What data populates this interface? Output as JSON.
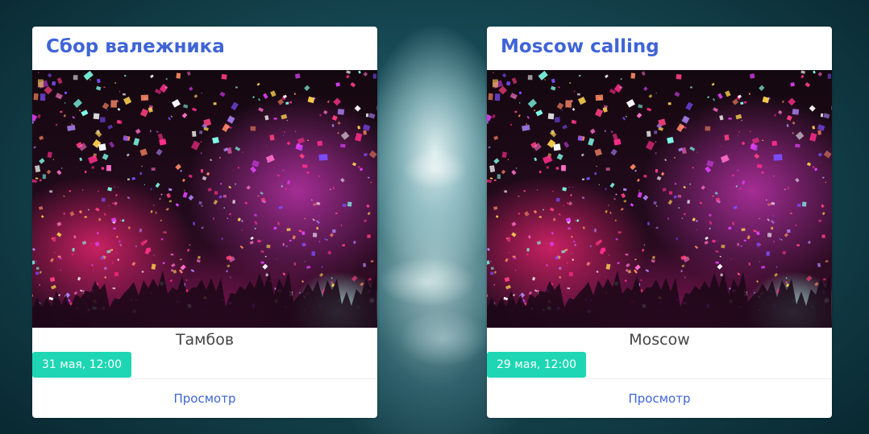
{
  "cards": [
    {
      "title": "Сбор валежника",
      "city": "Тамбов",
      "date": "31 мая, 12:00",
      "action_label": "Просмотр",
      "image": "concert-confetti-photo"
    },
    {
      "title": "Moscow calling",
      "city": "Moscow",
      "date": "29 мая, 12:00",
      "action_label": "Просмотр",
      "image": "concert-confetti-photo"
    }
  ],
  "colors": {
    "title": "#3f64d6",
    "badge": "#1ed6b3",
    "link": "#3f64d6"
  }
}
